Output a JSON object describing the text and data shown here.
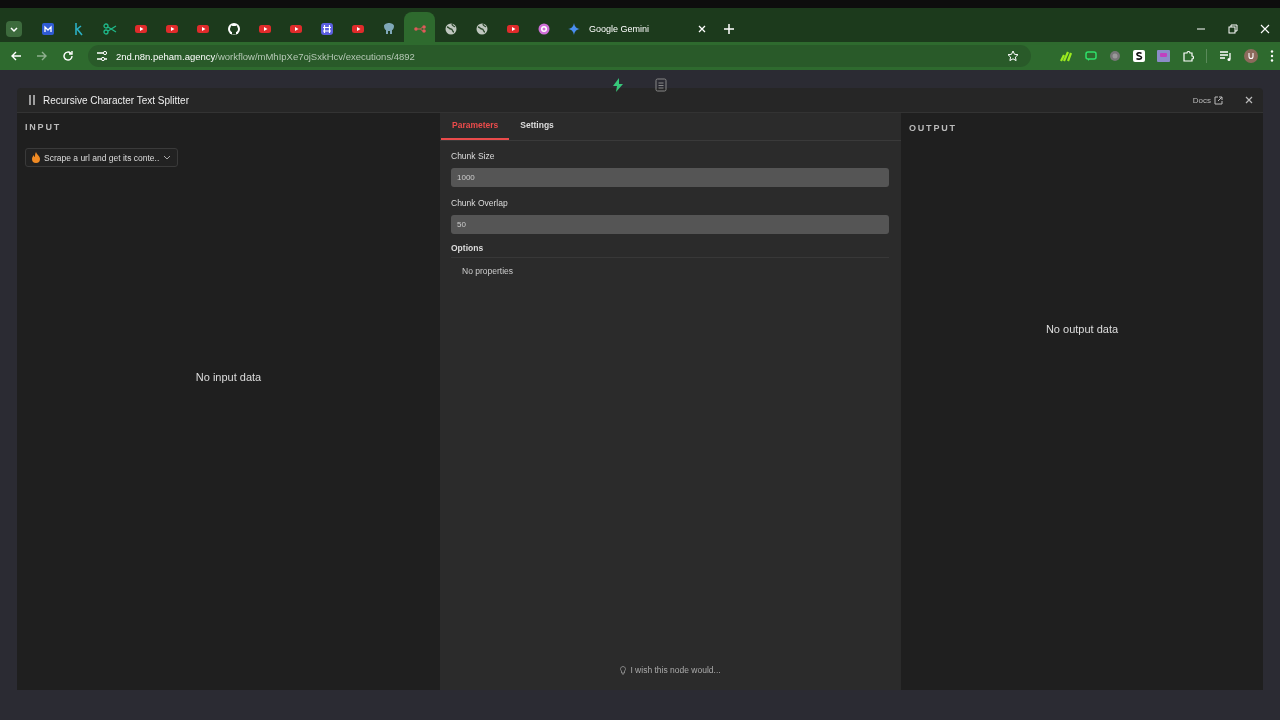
{
  "browser": {
    "tabs": [
      {
        "kind": "m",
        "selected": false
      },
      {
        "kind": "k",
        "selected": false
      },
      {
        "kind": "scissors",
        "selected": false
      },
      {
        "kind": "video",
        "selected": false
      },
      {
        "kind": "video",
        "selected": false
      },
      {
        "kind": "video",
        "selected": false
      },
      {
        "kind": "github",
        "selected": false
      },
      {
        "kind": "video",
        "selected": false
      },
      {
        "kind": "video",
        "selected": false
      },
      {
        "kind": "grid",
        "selected": false
      },
      {
        "kind": "video",
        "selected": false
      },
      {
        "kind": "elephant",
        "selected": false
      },
      {
        "kind": "workflow",
        "selected": true
      },
      {
        "kind": "globe",
        "selected": false
      },
      {
        "kind": "globe",
        "selected": false
      },
      {
        "kind": "video",
        "selected": false
      },
      {
        "kind": "ring",
        "selected": false
      },
      {
        "kind": "sparkle",
        "selected": false,
        "title": "Google Gemini"
      }
    ],
    "url": {
      "host": "2nd.n8n.peham.agency",
      "path": "/workflow/mMhIpXe7ojSxkHcv/executions/4892"
    }
  },
  "node_panel": {
    "title": "Recursive Character Text Splitter",
    "docs_label": "Docs",
    "input": {
      "heading": "INPUT",
      "source_selector": "Scrape a url and get its conte..",
      "empty_text": "No input data"
    },
    "parameters": {
      "tabs": [
        {
          "label": "Parameters",
          "selected": true
        },
        {
          "label": "Settings",
          "selected": false
        }
      ],
      "fields": [
        {
          "label": "Chunk Size",
          "value": "1000"
        },
        {
          "label": "Chunk Overlap",
          "value": "50"
        }
      ],
      "options_label": "Options",
      "options_empty": "No properties",
      "feedback": "I wish this node would..."
    },
    "output": {
      "heading": "OUTPUT",
      "empty_text": "No output data"
    }
  }
}
